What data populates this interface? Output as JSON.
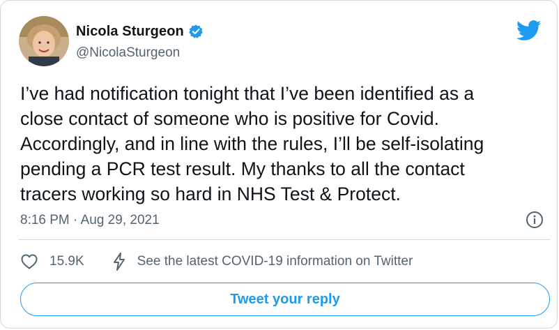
{
  "author": {
    "name": "Nicola Sturgeon",
    "handle": "@NicolaSturgeon",
    "verified": true
  },
  "tweet": {
    "text": "I’ve had notification tonight that I’ve been identified as a\nclose contact of someone who is positive for Covid.\nAccordingly, and in line with the rules, I’ll be self-isolating\npending a PCR test result. My thanks to all the contact\ntracers working so hard in NHS Test & Protect.",
    "timestamp": "8:16 PM · Aug 29, 2021"
  },
  "actions": {
    "like_count": "15.9K",
    "covid_info": "See the latest COVID-19 information on Twitter"
  },
  "reply_button": "Tweet your reply",
  "icons": {
    "logo": "twitter-bird-icon",
    "verified": "verified-badge-icon",
    "info": "info-icon",
    "like": "heart-icon",
    "covid": "lightning-icon"
  },
  "colors": {
    "accent": "#1d9bf0",
    "text": "#0f1419",
    "secondary": "#536471",
    "border": "#cfd9de"
  }
}
